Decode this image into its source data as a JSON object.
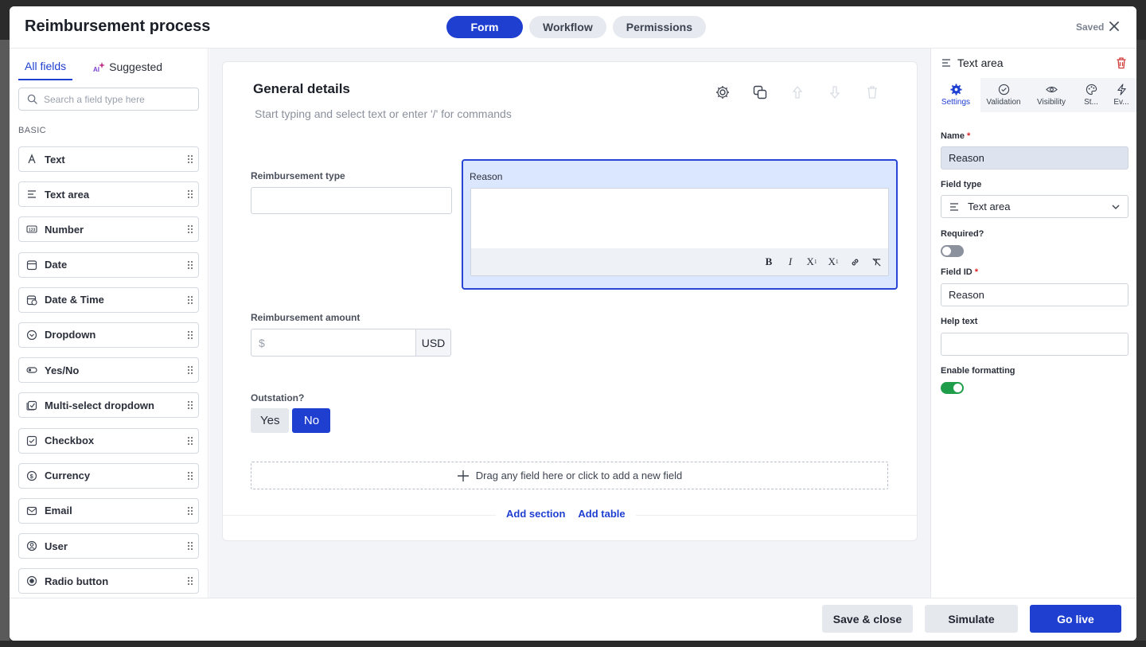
{
  "header": {
    "title": "Reimbursement process",
    "tabs": [
      "Form",
      "Workflow",
      "Permissions"
    ],
    "saved": "Saved"
  },
  "left": {
    "tabs": [
      "All fields",
      "Suggested"
    ],
    "search_placeholder": "Search a field type here",
    "section": "BASIC",
    "fields": [
      {
        "label": "Text",
        "icon": "text-icon"
      },
      {
        "label": "Text area",
        "icon": "text-area-icon"
      },
      {
        "label": "Number",
        "icon": "number-icon"
      },
      {
        "label": "Date",
        "icon": "calendar-icon"
      },
      {
        "label": "Date & Time",
        "icon": "calendar-clock-icon"
      },
      {
        "label": "Dropdown",
        "icon": "dropdown-icon"
      },
      {
        "label": "Yes/No",
        "icon": "toggle-icon"
      },
      {
        "label": "Multi-select dropdown",
        "icon": "multi-check-icon"
      },
      {
        "label": "Checkbox",
        "icon": "checkbox-icon"
      },
      {
        "label": "Currency",
        "icon": "dollar-icon"
      },
      {
        "label": "Email",
        "icon": "mail-icon"
      },
      {
        "label": "User",
        "icon": "user-icon"
      },
      {
        "label": "Radio button",
        "icon": "radio-icon"
      }
    ]
  },
  "canvas": {
    "section_title": "General details",
    "section_hint": "Start typing and select text or enter '/' for commands",
    "reimbursement_type_label": "Reimbursement type",
    "reason_label": "Reason",
    "amount_label": "Reimbursement amount",
    "amount_prefix": "$",
    "amount_currency": "USD",
    "outstation_label": "Outstation?",
    "yes_label": "Yes",
    "no_label": "No",
    "dropzone": "Drag any field here or click to add a new field",
    "add_section": "Add section",
    "add_table": "Add table"
  },
  "right": {
    "title": "Text area",
    "tabs": [
      "Settings",
      "Validation",
      "Visibility",
      "St...",
      "Ev..."
    ],
    "name_label": "Name",
    "name_value": "Reason",
    "field_type_label": "Field type",
    "field_type_value": "Text area",
    "required_label": "Required?",
    "required_on": false,
    "field_id_label": "Field ID",
    "field_id_value": "Reason",
    "help_text_label": "Help text",
    "help_text_value": "",
    "formatting_label": "Enable formatting",
    "formatting_on": true
  },
  "footer": {
    "save_close": "Save & close",
    "simulate": "Simulate",
    "go_live": "Go live"
  },
  "colors": {
    "accent": "#1f3fd1",
    "selected_bg": "#dbe6ff",
    "toggle_on": "#1e9e4a",
    "toggle_off": "#8b919d",
    "danger": "#d23a3a"
  }
}
